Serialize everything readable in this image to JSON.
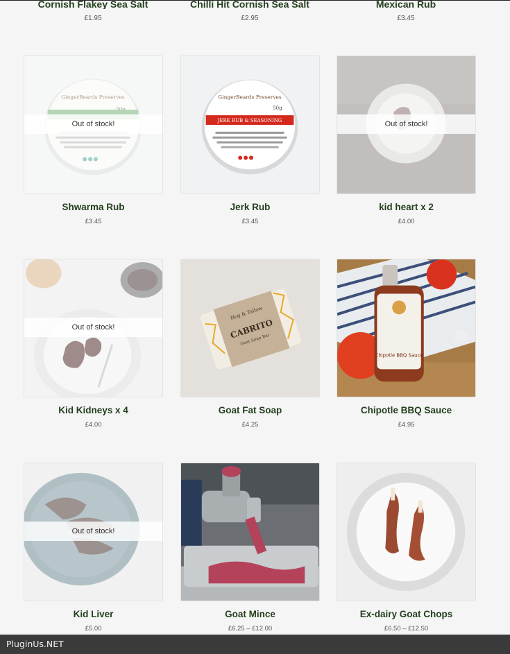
{
  "top_row": [
    {
      "name": "Cornish Flakey Sea Salt",
      "price": "£1.95"
    },
    {
      "name": "Chilli Hit Cornish Sea Salt",
      "price": "£2.95"
    },
    {
      "name": "Mexican Rub",
      "price": "£3.45"
    }
  ],
  "products": [
    {
      "name": "Shwarma Rub",
      "price": "£3.45",
      "badge": "Out of stock!",
      "image_icon": "spice-tin-image",
      "image_label": "GingerBeards Preserves",
      "image_weight": "50g"
    },
    {
      "name": "Jerk Rub",
      "price": "£3.45",
      "badge": "",
      "image_icon": "spice-tin-image",
      "image_label": "GingerBeards Preserves",
      "image_band": "JERK RUB & SEASONING",
      "image_weight": "50g"
    },
    {
      "name": "kid heart x 2",
      "price": "£4.00",
      "badge": "Out of stock!",
      "image_icon": "heart-on-plate-image"
    },
    {
      "name": "Kid Kidneys x 4",
      "price": "£4.00",
      "badge": "Out of stock!",
      "image_icon": "kidneys-on-plate-image"
    },
    {
      "name": "Goat Fat Soap",
      "price": "£4.25",
      "badge": "",
      "image_icon": "soap-bar-image",
      "image_brand": "Hog & Tallow",
      "image_title": "CABRITO",
      "image_sub": "Goat Soap Bar"
    },
    {
      "name": "Chipotle BBQ Sauce",
      "price": "£4.95",
      "badge": "",
      "image_icon": "sauce-bottle-image",
      "image_label": "Chipotle BBQ Sauce"
    },
    {
      "name": "Kid Liver",
      "price": "£5.00",
      "badge": "Out of stock!",
      "image_icon": "liver-on-plate-image"
    },
    {
      "name": "Goat Mince",
      "price": "£6.25 – £12.00",
      "badge": "",
      "image_icon": "mincer-image"
    },
    {
      "name": "Ex-dairy Goat Chops",
      "price": "£6.50 – £12.50",
      "badge": "",
      "image_icon": "chops-on-plate-image"
    }
  ],
  "footer": {
    "text": "PluginUs.NET"
  }
}
